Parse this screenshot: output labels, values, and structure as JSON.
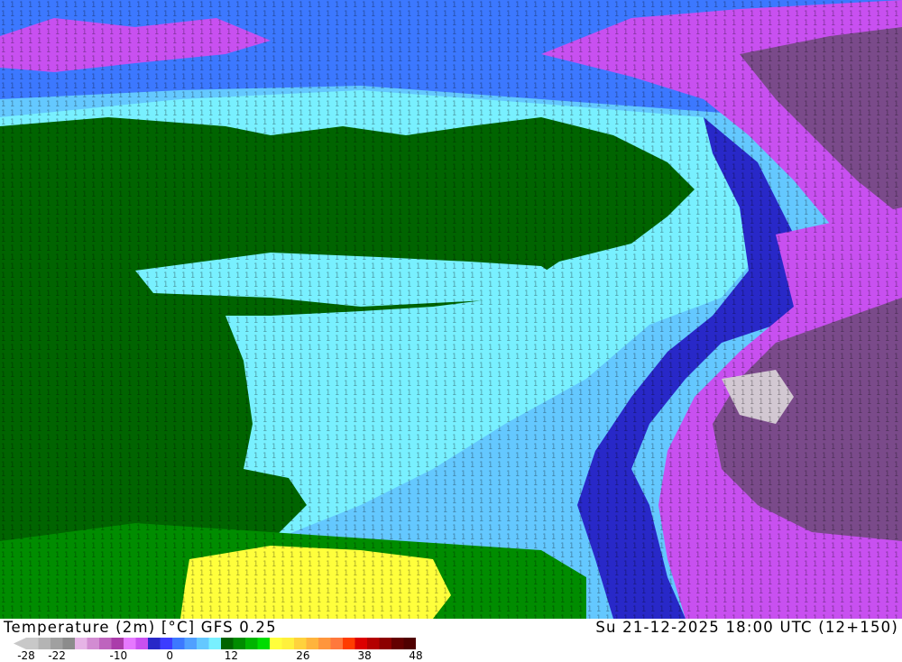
{
  "header": {
    "left_title": "Temperature (2m) [°C] GFS 0.25",
    "right_title": "Su 21-12-2025 18:00 UTC (12+150)"
  },
  "legend": {
    "ticks": [
      {
        "label": "-28",
        "value": -28
      },
      {
        "label": "-22",
        "value": -22
      },
      {
        "label": "-10",
        "value": -10
      },
      {
        "label": "0",
        "value": 0
      },
      {
        "label": "12",
        "value": 12
      },
      {
        "label": "26",
        "value": 26
      },
      {
        "label": "38",
        "value": 38
      },
      {
        "label": "48",
        "value": 48
      }
    ],
    "min": -28,
    "max": 48,
    "colors": [
      "#c8c8c8",
      "#b4b4b4",
      "#a0a0a0",
      "#8c8c8c",
      "#e6b4e6",
      "#d28cd2",
      "#be64be",
      "#aa3caa",
      "#e678ff",
      "#c850f0",
      "#2828c8",
      "#3c3cff",
      "#3c78ff",
      "#50a0ff",
      "#64c8ff",
      "#78f0ff",
      "#006400",
      "#008c00",
      "#00b400",
      "#00dc00",
      "#ffff3c",
      "#fff03c",
      "#ffd23c",
      "#ffb43c",
      "#ff963c",
      "#ff783c",
      "#ff3c00",
      "#dc0000",
      "#b40000",
      "#8c0000",
      "#640000",
      "#500000"
    ]
  },
  "map": {
    "colors": {
      "ocean_cold": "#3c78ff",
      "deep_blue": "#2828c8",
      "cyan": "#3cdcf0",
      "light_cyan": "#78f0ff",
      "green": "#006400",
      "bright_green": "#008c00",
      "magenta": "#c850f0",
      "purple": "#7a4a8a",
      "yellow": "#ffff3c",
      "white_gray": "#d2c8d2"
    }
  }
}
